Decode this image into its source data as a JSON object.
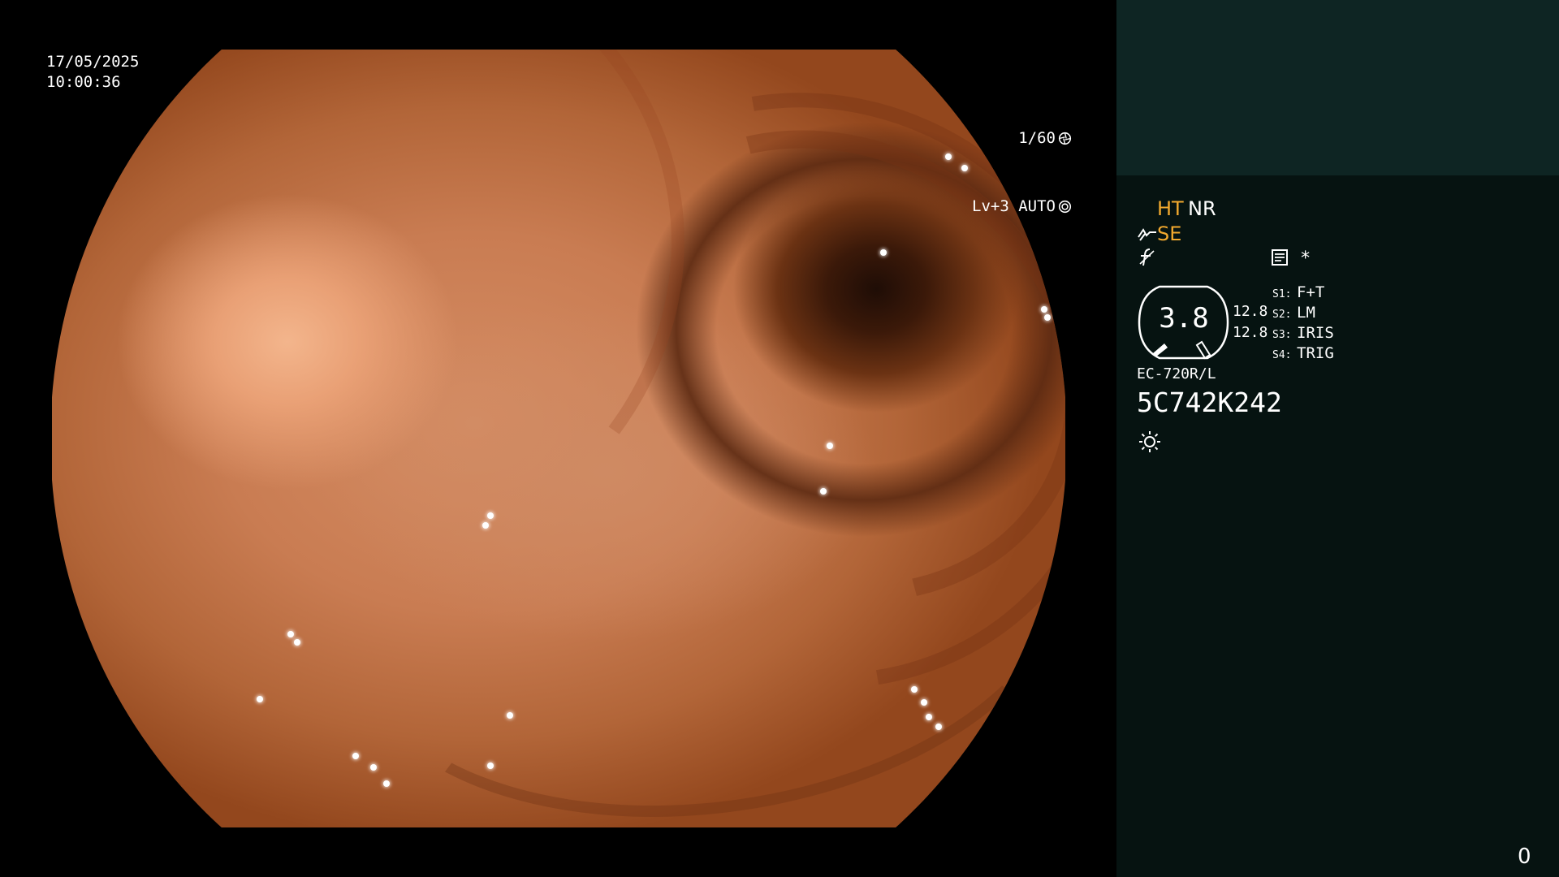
{
  "overlay": {
    "date": "17/05/2025",
    "time": "10:00:36",
    "shutter_speed": "1/60",
    "shutter_icon": "aperture-icon",
    "iris_level": "Lv+3 AUTO",
    "iris_icon": "iris-auto-icon"
  },
  "panel": {
    "modes": {
      "ht": "HT",
      "nr": "NR",
      "se": "SE"
    },
    "icons": {
      "enhance": "enhancement-icon",
      "freeze": "freeze-icon",
      "record": "record-icon",
      "light": "light-source-icon"
    },
    "asterisk": "*",
    "gauge": {
      "value": "3.8",
      "left_value": "12.8",
      "right_value": "12.8"
    },
    "switches": [
      {
        "key": "S1:",
        "value": "F+T"
      },
      {
        "key": "S2:",
        "value": "LM"
      },
      {
        "key": "S3:",
        "value": "IRIS"
      },
      {
        "key": "S4:",
        "value": "TRIG"
      }
    ],
    "scope_model": "EC-720R/L",
    "scope_serial": "5C742K242",
    "counter": "0"
  },
  "colors": {
    "accent_orange": "#f2a92e",
    "panel_bg": "#061311",
    "panel_top_bg": "#0e2523",
    "text": "#ffffff"
  }
}
